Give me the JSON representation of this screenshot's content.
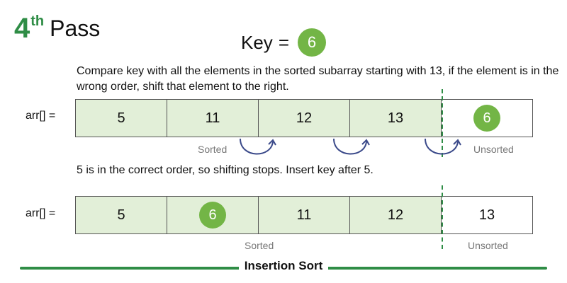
{
  "pass": {
    "number": "4",
    "suffix": "th",
    "word": "Pass"
  },
  "key": {
    "label": "Key",
    "equals": "=",
    "value": "6"
  },
  "description": "Compare key  with all the elements in the sorted subarray starting with 13, if the element is in the wrong order, shift that element to the right.",
  "array1": {
    "label": "arr[] =",
    "cells": [
      "5",
      "11",
      "12",
      "13",
      "6"
    ],
    "sorted_caption": "Sorted",
    "unsorted_caption": "Unsorted"
  },
  "note": "5 is in the correct order, so shifting stops. Insert key after 5.",
  "array2": {
    "label": "arr[] =",
    "cells": [
      "5",
      "6",
      "11",
      "12",
      "13"
    ],
    "sorted_caption": "Sorted",
    "unsorted_caption": "Unsorted"
  },
  "footer": {
    "title": "Insertion Sort"
  },
  "colors": {
    "green": "#2f8d46",
    "highlight": "#73b546",
    "sorted_fill": "#e2efd8"
  }
}
